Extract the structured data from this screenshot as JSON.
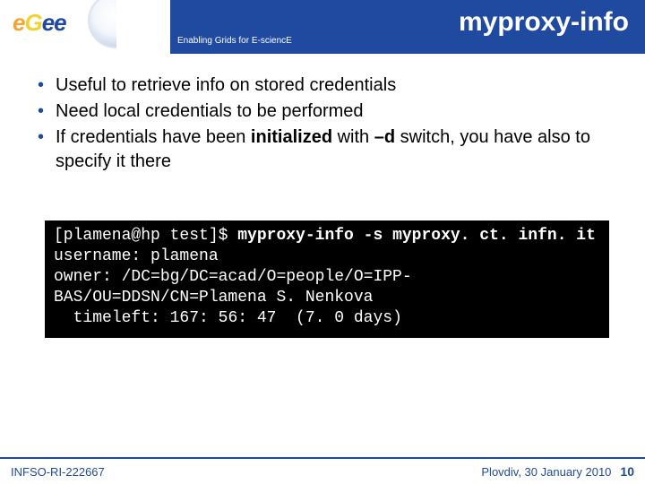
{
  "banner": {
    "tagline": "Enabling Grids for E-sciencE",
    "title": "myproxy-info"
  },
  "bullets": {
    "b0": "Useful to retrieve info on stored credentials",
    "b1": "Need local credentials to be performed",
    "b2_pre": "If credentials have been ",
    "b2_strong1": "initialized",
    "b2_mid": " with ",
    "b2_strong2": "–d",
    "b2_post": " switch, you have also to specify it there"
  },
  "terminal": {
    "prompt": "[plamena@hp test]$ ",
    "cmd": "myproxy-info -s myproxy. ct. infn. it",
    "line2": "username: plamena",
    "line3": "owner: /DC=bg/DC=acad/O=people/O=IPP-",
    "line4": "BAS/OU=DDSN/CN=Plamena S. Nenkova",
    "line5": "  timeleft: 167: 56: 47  (7. 0 days)"
  },
  "footer": {
    "left": "INFSO-RI-222667",
    "right_text": "Plovdiv, 30 January 2010",
    "page": "10"
  }
}
